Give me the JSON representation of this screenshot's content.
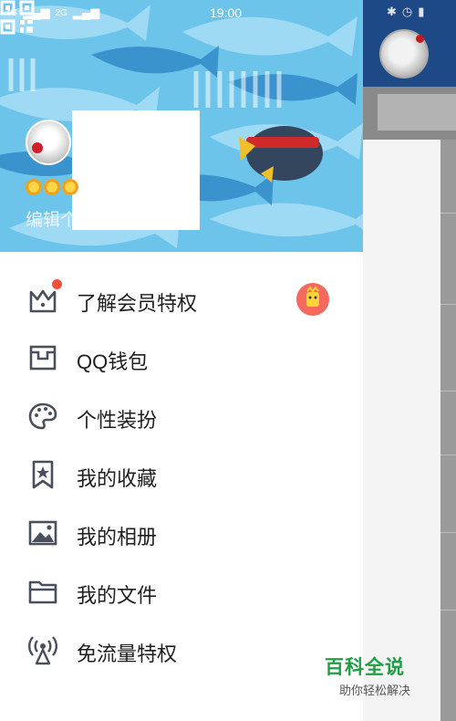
{
  "status_bar": {
    "time": "19:00",
    "network_left": "4G",
    "network_right": "2G"
  },
  "profile": {
    "edit_label": "编辑个"
  },
  "menu": {
    "items": [
      {
        "label": "了解会员特权",
        "icon": "crown-icon",
        "has_dot": true,
        "badge": "mascot-badge"
      },
      {
        "label": "QQ钱包",
        "icon": "wallet-icon"
      },
      {
        "label": "个性装扮",
        "icon": "palette-icon"
      },
      {
        "label": "我的收藏",
        "icon": "bookmark-star-icon"
      },
      {
        "label": "我的相册",
        "icon": "photo-icon"
      },
      {
        "label": "我的文件",
        "icon": "folder-icon"
      },
      {
        "label": "免流量特权",
        "icon": "broadcast-icon"
      }
    ]
  },
  "watermark": {
    "title": "百科全说",
    "subtitle": "助你轻松解决"
  },
  "colors": {
    "banner": "#6cc4ea",
    "accent_dot": "#f0513b",
    "watermark_green": "#1f9e44",
    "icon_gray": "#4a4f5c"
  }
}
